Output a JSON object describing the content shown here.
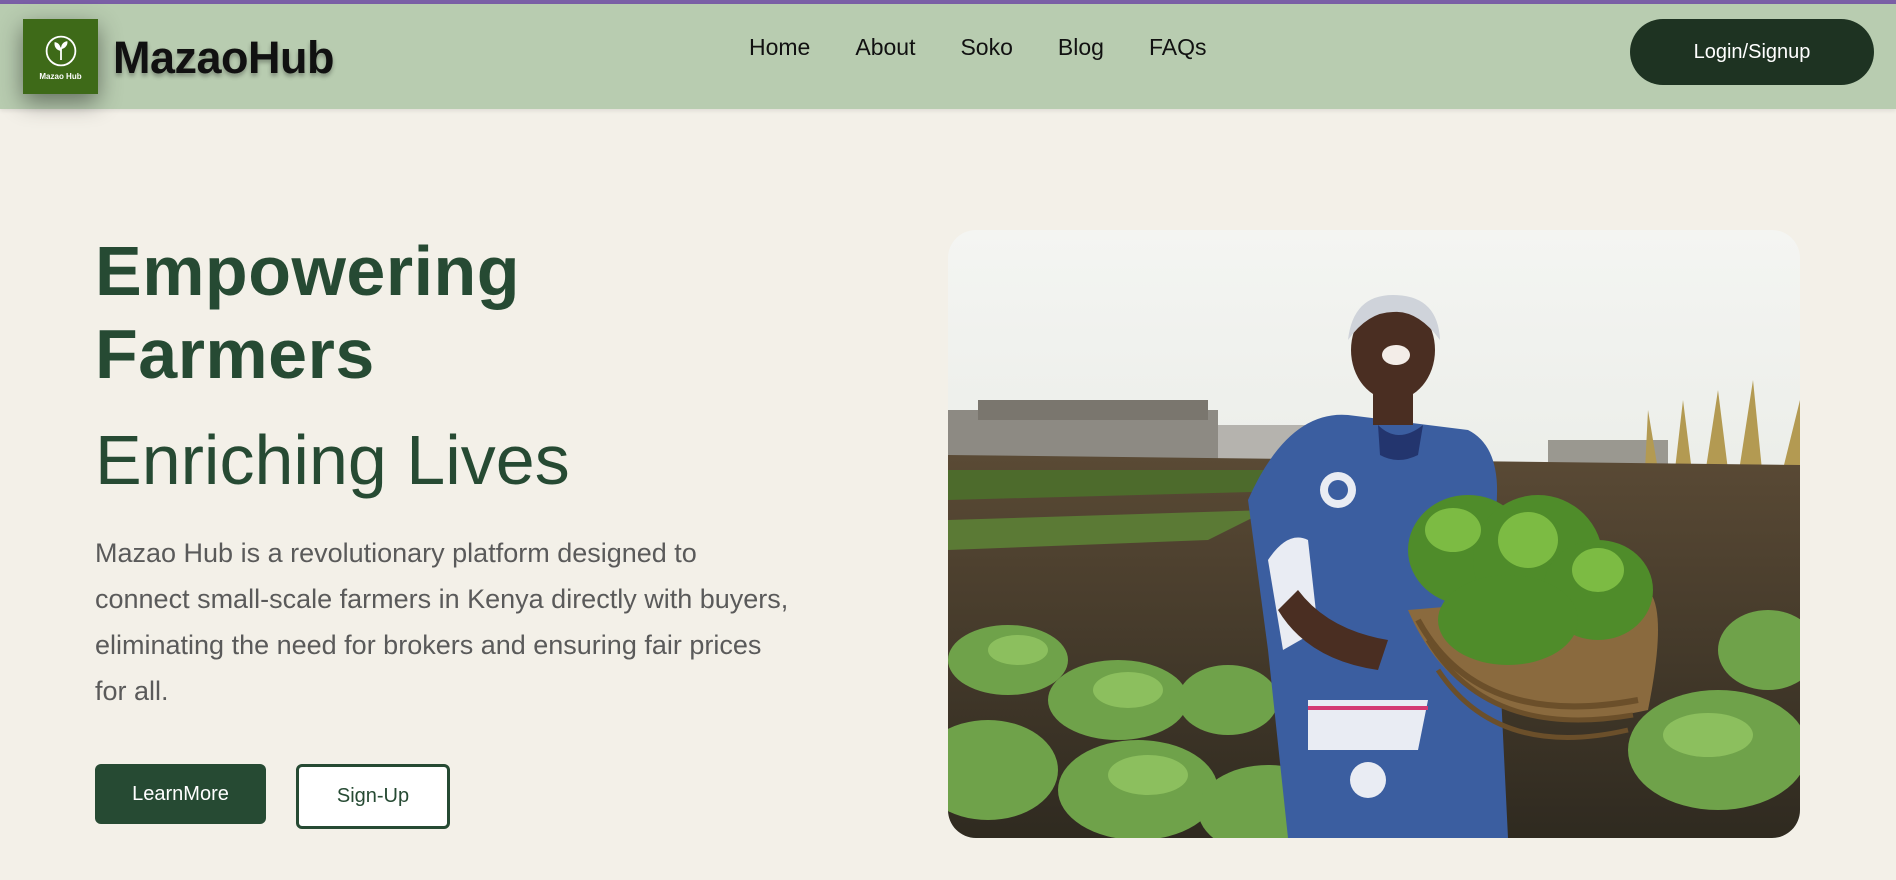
{
  "header": {
    "logo_text": "Mazao Hub",
    "brand": "MazaoHub",
    "nav": [
      {
        "label": "Home"
      },
      {
        "label": "About"
      },
      {
        "label": "Soko"
      },
      {
        "label": "Blog"
      },
      {
        "label": "FAQs"
      }
    ],
    "login_label": "Login/Signup"
  },
  "hero": {
    "title": "Empowering Farmers",
    "subtitle": "Enriching Lives",
    "description": "Mazao Hub is a revolutionary platform designed to connect small-scale farmers in Kenya directly with buyers, eliminating the need for brokers and ensuring fair prices for all.",
    "learn_more_label": "LearnMore",
    "signup_label": "Sign-Up"
  },
  "colors": {
    "nav_bg": "#b8ccb0",
    "primary": "#264a33",
    "page_bg": "#f3f0e8",
    "logo_bg": "#3e6a18",
    "accent_line": "#7a5fa6"
  }
}
